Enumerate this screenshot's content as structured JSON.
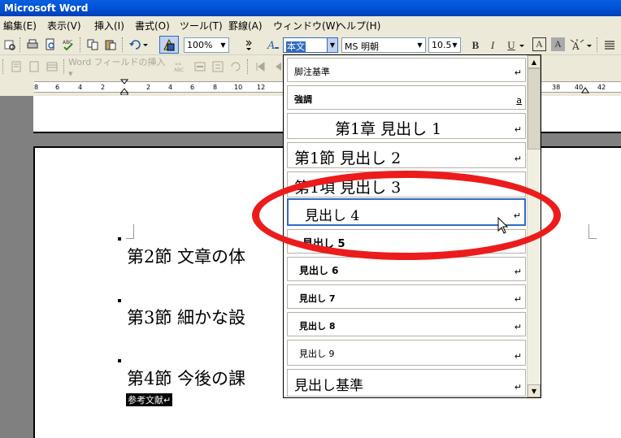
{
  "window": {
    "title": "Microsoft Word"
  },
  "menu": [
    {
      "label": "編集(E)"
    },
    {
      "label": "表示(V)"
    },
    {
      "label": "挿入(I)"
    },
    {
      "label": "書式(O)"
    },
    {
      "label": "ツール(T)"
    },
    {
      "label": "罫線(A)"
    },
    {
      "label": "ウィンドウ(W)"
    },
    {
      "label": "ヘルプ(H)"
    }
  ],
  "toolbar": {
    "zoom": "100%",
    "style": "本文",
    "font": "MS 明朝",
    "size": "10.5",
    "bold": "B",
    "italic": "I",
    "underline": "U",
    "char_border": "A",
    "char_shading": "A",
    "phonetic": "A"
  },
  "mail_toolbar": {
    "insert_field": "Word フィールドの挿入 ▾",
    "abc": "≪≫\nABC"
  },
  "ruler": {
    "left_numbers": [
      "8",
      "6",
      "4",
      "2"
    ],
    "right_numbers": [
      "2",
      "4",
      "6",
      "8",
      "10",
      "12"
    ],
    "far_right": [
      "38",
      "40",
      "42"
    ]
  },
  "document": {
    "headings": [
      "第2節 文章の体",
      "第3節 細かな設",
      "第4節 今後の課"
    ],
    "selected_text": "参考文献↵"
  },
  "style_list": {
    "items": [
      {
        "label": "脚注基準",
        "mark": "↵"
      },
      {
        "label": "強調",
        "mark": "a"
      },
      {
        "label": "第1章 見出し 1",
        "mark": "↵"
      },
      {
        "label": "第1節 見出し 2",
        "mark": "↵"
      },
      {
        "label": "第1項 見出し 3",
        "mark": "↵"
      },
      {
        "label": "見出し 4",
        "mark": "↵"
      },
      {
        "label": "見出し 5",
        "mark": "↵"
      },
      {
        "label": "見出し 6",
        "mark": "↵"
      },
      {
        "label": "見出し 7",
        "mark": "↵"
      },
      {
        "label": "見出し 8",
        "mark": "↵"
      },
      {
        "label": "見出し 9",
        "mark": "↵"
      },
      {
        "label": "見出し基準",
        "mark": "↵"
      }
    ]
  },
  "colors": {
    "annotation": "#ec1c1c",
    "title_bar": "#0052d6",
    "selection": "#000000"
  }
}
